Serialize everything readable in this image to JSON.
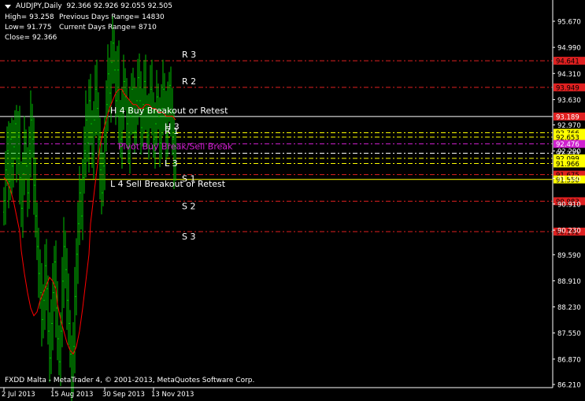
{
  "header": {
    "symbol_line": "AUDJPY,Daily  92.366 92.926 92.055 92.505",
    "info": [
      "High= 93.258",
      "Low= 91.775",
      "Close= 92.366"
    ],
    "info2": [
      "Previous Days Range= 14830",
      "Current Days Range= 8710"
    ]
  },
  "footer": {
    "copyright": "FXDD Malta - MetaTrader 4, © 2001-2013, MetaQuotes Software Corp."
  },
  "colors": {
    "background": "#000000",
    "bull": "#00c000",
    "bear": "#00c000",
    "ma": "#ff0000",
    "resistance": "#e02020",
    "pivot": "#d020d0",
    "level_yellow": "#ffff00",
    "level_white": "#ffffff",
    "text": "#ffffff"
  },
  "chart_data": {
    "type": "candlestick",
    "title": "AUDJPY,Daily",
    "ylim": [
      86.0,
      96.0
    ],
    "y_ticks": [
      "95.670",
      "94.990",
      "94.310",
      "93.630",
      "92.970",
      "92.290",
      "91.580",
      "90.910",
      "90.230",
      "89.590",
      "88.910",
      "88.230",
      "87.550",
      "86.870",
      "86.210"
    ],
    "x_ticks": [
      {
        "label": "2 Jul 2013",
        "bar": 0
      },
      {
        "label": "15 Aug 2013",
        "bar": 31
      },
      {
        "label": "30 Sep 2013",
        "bar": 64
      },
      {
        "label": "13 Nov 2013",
        "bar": 95
      }
    ],
    "levels": [
      {
        "name": "R 3",
        "value": 94.641,
        "label": "94.641",
        "style": "dashdot",
        "color": "#e02020",
        "tag_bg": "#e02020",
        "tag_fg": "#000000"
      },
      {
        "name": "R 2",
        "value": 93.949,
        "label": "93.949",
        "style": "dashdot",
        "color": "#e02020",
        "tag_bg": "#e02020",
        "tag_fg": "#000000"
      },
      {
        "name": "H 4 Buy Breakout or Retest",
        "value": 93.189,
        "label": "93.189",
        "style": "solid",
        "color": "#ffffff",
        "tag_bg": "#e02020",
        "tag_fg": "#ffffff"
      },
      {
        "name": "H 3",
        "value": 92.766,
        "label": "92.766",
        "style": "dashdot",
        "color": "#ffff00",
        "tag_bg": "#ffff00",
        "tag_fg": "#000000"
      },
      {
        "name": "R 1",
        "value": 92.653,
        "label": "92.653",
        "style": "dashdot",
        "color": "#ffff00",
        "tag_bg": "#ffff00",
        "tag_fg": "#000000"
      },
      {
        "name": "Pivot Buy Break/Sell Break",
        "value": 92.476,
        "label": "92.476",
        "style": "dashdot",
        "color": "#d020d0",
        "tag_bg": "#d020d0",
        "tag_fg": "#ffffff"
      },
      {
        "name": "",
        "value": 92.233,
        "label": "92.233",
        "style": "dashdot",
        "color": "#ffffff",
        "tag_bg": "#000000",
        "tag_fg": "#ffffff"
      },
      {
        "name": "L 3",
        "value": 92.099,
        "label": "92.099",
        "style": "dashdot",
        "color": "#ffff00",
        "tag_bg": "#ffff00",
        "tag_fg": "#000000"
      },
      {
        "name": "",
        "value": 91.966,
        "label": "91.966",
        "style": "dashdot",
        "color": "#ffff00",
        "tag_bg": "#ffff00",
        "tag_fg": "#000000"
      },
      {
        "name": "S 1",
        "value": 91.675,
        "label": "91.675",
        "style": "dashdot",
        "color": "#e02020",
        "tag_bg": "#e02020",
        "tag_fg": "#000000"
      },
      {
        "name": "L 4 Sell Breakout or Retest",
        "value": 91.55,
        "label": "91.550",
        "style": "solid",
        "color": "#ffff00",
        "tag_bg": "#ffff00",
        "tag_fg": "#000000"
      },
      {
        "name": "S 2",
        "value": 90.983,
        "label": "90.983",
        "style": "dashdot",
        "color": "#e02020",
        "tag_bg": "#e02020",
        "tag_fg": "#000000"
      },
      {
        "name": "S 3",
        "value": 90.192,
        "label": "90.192",
        "style": "dashdot",
        "color": "#e02020",
        "tag_bg": "#e02020",
        "tag_fg": "#000000"
      }
    ],
    "closes": [
      91.0,
      91.8,
      92.3,
      91.5,
      92.6,
      91.9,
      92.4,
      93.0,
      92.1,
      92.7,
      91.6,
      90.8,
      91.7,
      92.5,
      91.9,
      91.2,
      92.3,
      93.1,
      92.6,
      91.4,
      90.6,
      89.8,
      89.1,
      88.6,
      87.9,
      88.4,
      89.3,
      88.7,
      87.6,
      86.9,
      87.8,
      88.6,
      89.4,
      88.2,
      87.4,
      86.8,
      87.6,
      88.9,
      89.8,
      89.2,
      88.4,
      87.8,
      87.0,
      86.4,
      87.2,
      88.5,
      89.6,
      90.4,
      91.2,
      90.6,
      91.6,
      92.3,
      93.1,
      92.5,
      93.6,
      93.0,
      92.2,
      93.1,
      93.9,
      93.4,
      92.6,
      91.8,
      91.2,
      91.9,
      92.7,
      93.5,
      94.3,
      93.8,
      94.6,
      95.1,
      94.4,
      93.6,
      94.4,
      93.2,
      92.6,
      93.4,
      94.1,
      93.7,
      93.0,
      92.4,
      93.2,
      93.9,
      93.5,
      92.8,
      93.6,
      94.2,
      93.6,
      92.9,
      93.5,
      94.1,
      93.4,
      92.7,
      93.3,
      93.9,
      93.4,
      92.6,
      93.0,
      93.7,
      93.2,
      92.5,
      93.4,
      93.9,
      93.3,
      92.7,
      93.4,
      94.0,
      93.3,
      92.6,
      92.0,
      92.4
    ],
    "ma": [
      91.6,
      91.5,
      91.3,
      91.0,
      90.6,
      90.2,
      89.7,
      89.1,
      88.6,
      88.2,
      88.0,
      88.1,
      88.4,
      88.6,
      88.8,
      89.0,
      88.9,
      88.7,
      88.3,
      87.9,
      87.6,
      87.3,
      87.1,
      87.0,
      87.2,
      87.6,
      88.2,
      88.9,
      89.6,
      90.4,
      91.1,
      91.8,
      92.4,
      92.8,
      93.1,
      93.4,
      93.6,
      93.8,
      93.9,
      93.9,
      93.8,
      93.7,
      93.6,
      93.5,
      93.5,
      93.4,
      93.4,
      93.5,
      93.5,
      93.4,
      93.4,
      93.3,
      93.3,
      93.3,
      93.2,
      93.2,
      93.2,
      93.1
    ],
    "ma_start_bar": 52
  }
}
